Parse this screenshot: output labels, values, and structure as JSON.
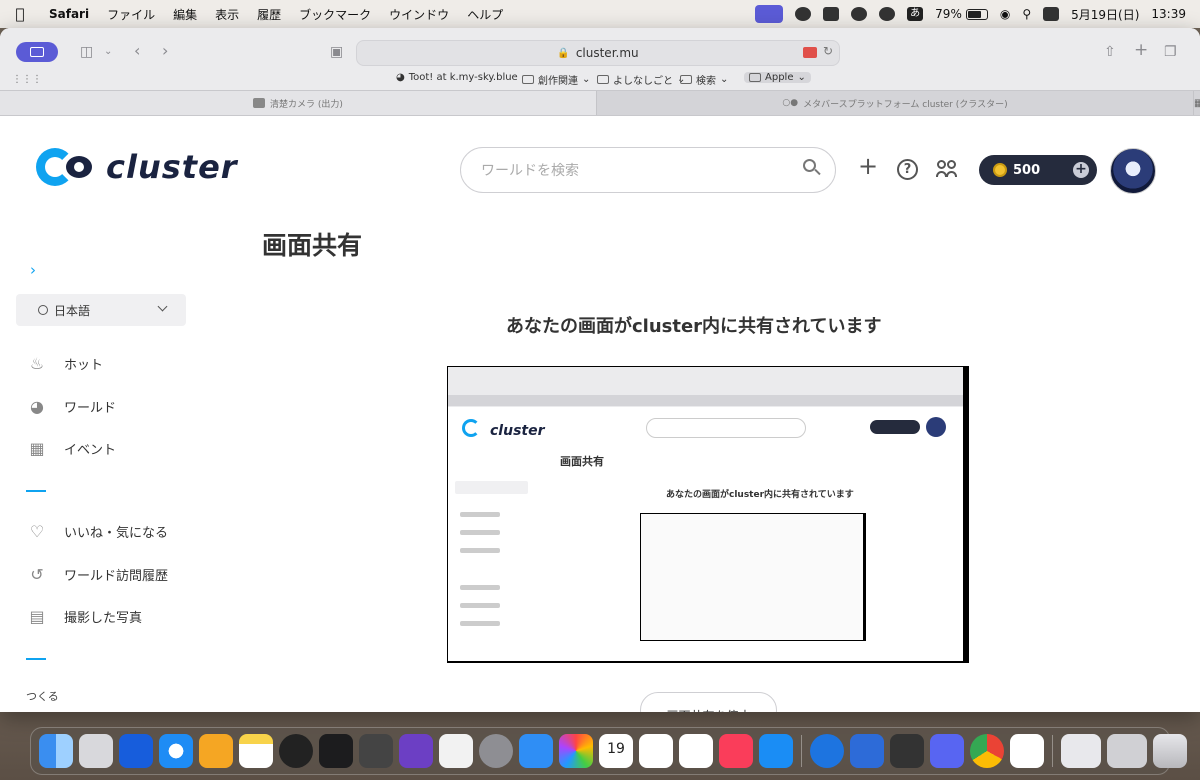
{
  "menubar": {
    "app": "Safari",
    "menus": [
      "ファイル",
      "編集",
      "表示",
      "履歴",
      "ブックマーク",
      "ウインドウ",
      "ヘルプ"
    ],
    "kana": "あ",
    "battery": "79%",
    "date": "5月19日(日)",
    "time": "13:39"
  },
  "browser": {
    "url": "cluster.mu",
    "bookmarks": [
      {
        "label": "Toot! at k.my-sky.blue",
        "type": "site"
      },
      {
        "label": "創作関連",
        "type": "folder"
      },
      {
        "label": "よしなしごと",
        "type": "folder"
      },
      {
        "label": "検索",
        "type": "folder"
      },
      {
        "label": "Apple",
        "type": "folder"
      }
    ],
    "tabs": [
      {
        "label": "清楚カメラ (出力)",
        "active": true
      },
      {
        "label": "メタバースプラットフォーム cluster (クラスター)",
        "active": false
      }
    ]
  },
  "site": {
    "logo_text": "cluster",
    "search_placeholder": "ワールドを検索",
    "coins": "500",
    "page_title": "画面共有",
    "language": "日本語",
    "nav": [
      {
        "label": "ホット",
        "icon": "flame-icon"
      },
      {
        "label": "ワールド",
        "icon": "globe-icon"
      },
      {
        "label": "イベント",
        "icon": "calendar-icon"
      }
    ],
    "nav2": [
      {
        "label": "いいね・気になる",
        "icon": "heart-icon"
      },
      {
        "label": "ワールド訪問履歴",
        "icon": "history-icon"
      },
      {
        "label": "撮影した写真",
        "icon": "photo-icon"
      }
    ],
    "section_label": "つくる",
    "share_heading": "あなたの画面がcluster内に共有されています",
    "stop_button": "画面共有を停止",
    "mini": {
      "logo_text": "cluster",
      "page_title": "画面共有",
      "share_heading": "あなたの画面がcluster内に共有されています"
    }
  },
  "colors": {
    "accent": "#0fa3f0",
    "navy": "#1a2340",
    "safari_active": "#5b5bd6",
    "coin_pill": "#252b3d"
  },
  "dock": [
    "finder",
    "launchpad",
    "bitwarden",
    "safari",
    "pages",
    "notes",
    "app-circle",
    "terminal",
    "server",
    "obsidian",
    "line",
    "system-settings",
    "mail",
    "photos",
    "calendar",
    "reminders",
    "freeform",
    "music",
    "app-store",
    "maps",
    "books",
    "unity",
    "discord",
    "chrome",
    "cluster",
    "preview",
    "downloads",
    "trash"
  ],
  "dock_calendar": {
    "month": "5月",
    "day": "19"
  }
}
